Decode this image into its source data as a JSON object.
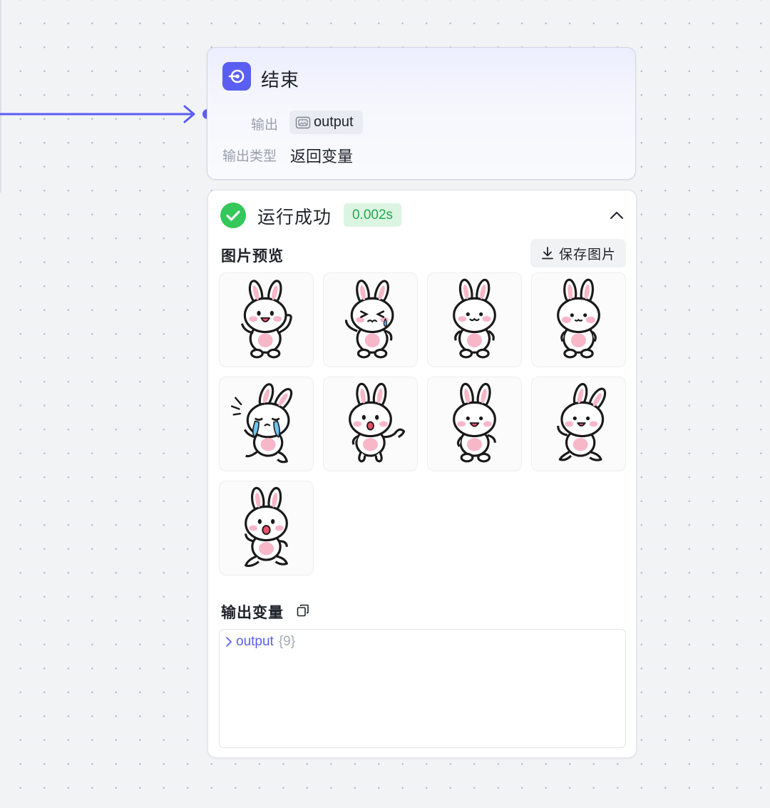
{
  "end_node": {
    "title": "结束",
    "output_label": "输出",
    "output_chip": "output",
    "output_type_label": "输出类型",
    "output_type_value": "返回变量"
  },
  "result": {
    "status": "运行成功",
    "duration": "0.002s",
    "image_preview_label": "图片预览",
    "save_button_label": "保存图片",
    "output_variables_label": "输出变量",
    "output_tree": {
      "key": "output",
      "count": "{9}"
    },
    "images": [
      {
        "icon": "bunny-waving-happy-icon"
      },
      {
        "icon": "bunny-crying-icon"
      },
      {
        "icon": "bunny-smiling-icon"
      },
      {
        "icon": "bunny-standing-icon"
      },
      {
        "icon": "bunny-running-crying-icon"
      },
      {
        "icon": "bunny-shouting-waving-icon"
      },
      {
        "icon": "bunny-cheerful-icon"
      },
      {
        "icon": "bunny-hopping-icon"
      },
      {
        "icon": "bunny-surprised-icon"
      }
    ]
  },
  "colors": {
    "accent": "#5b5ef2",
    "success": "#34c759",
    "success_text": "#23a84b",
    "canvas": "#f2f3f5"
  }
}
